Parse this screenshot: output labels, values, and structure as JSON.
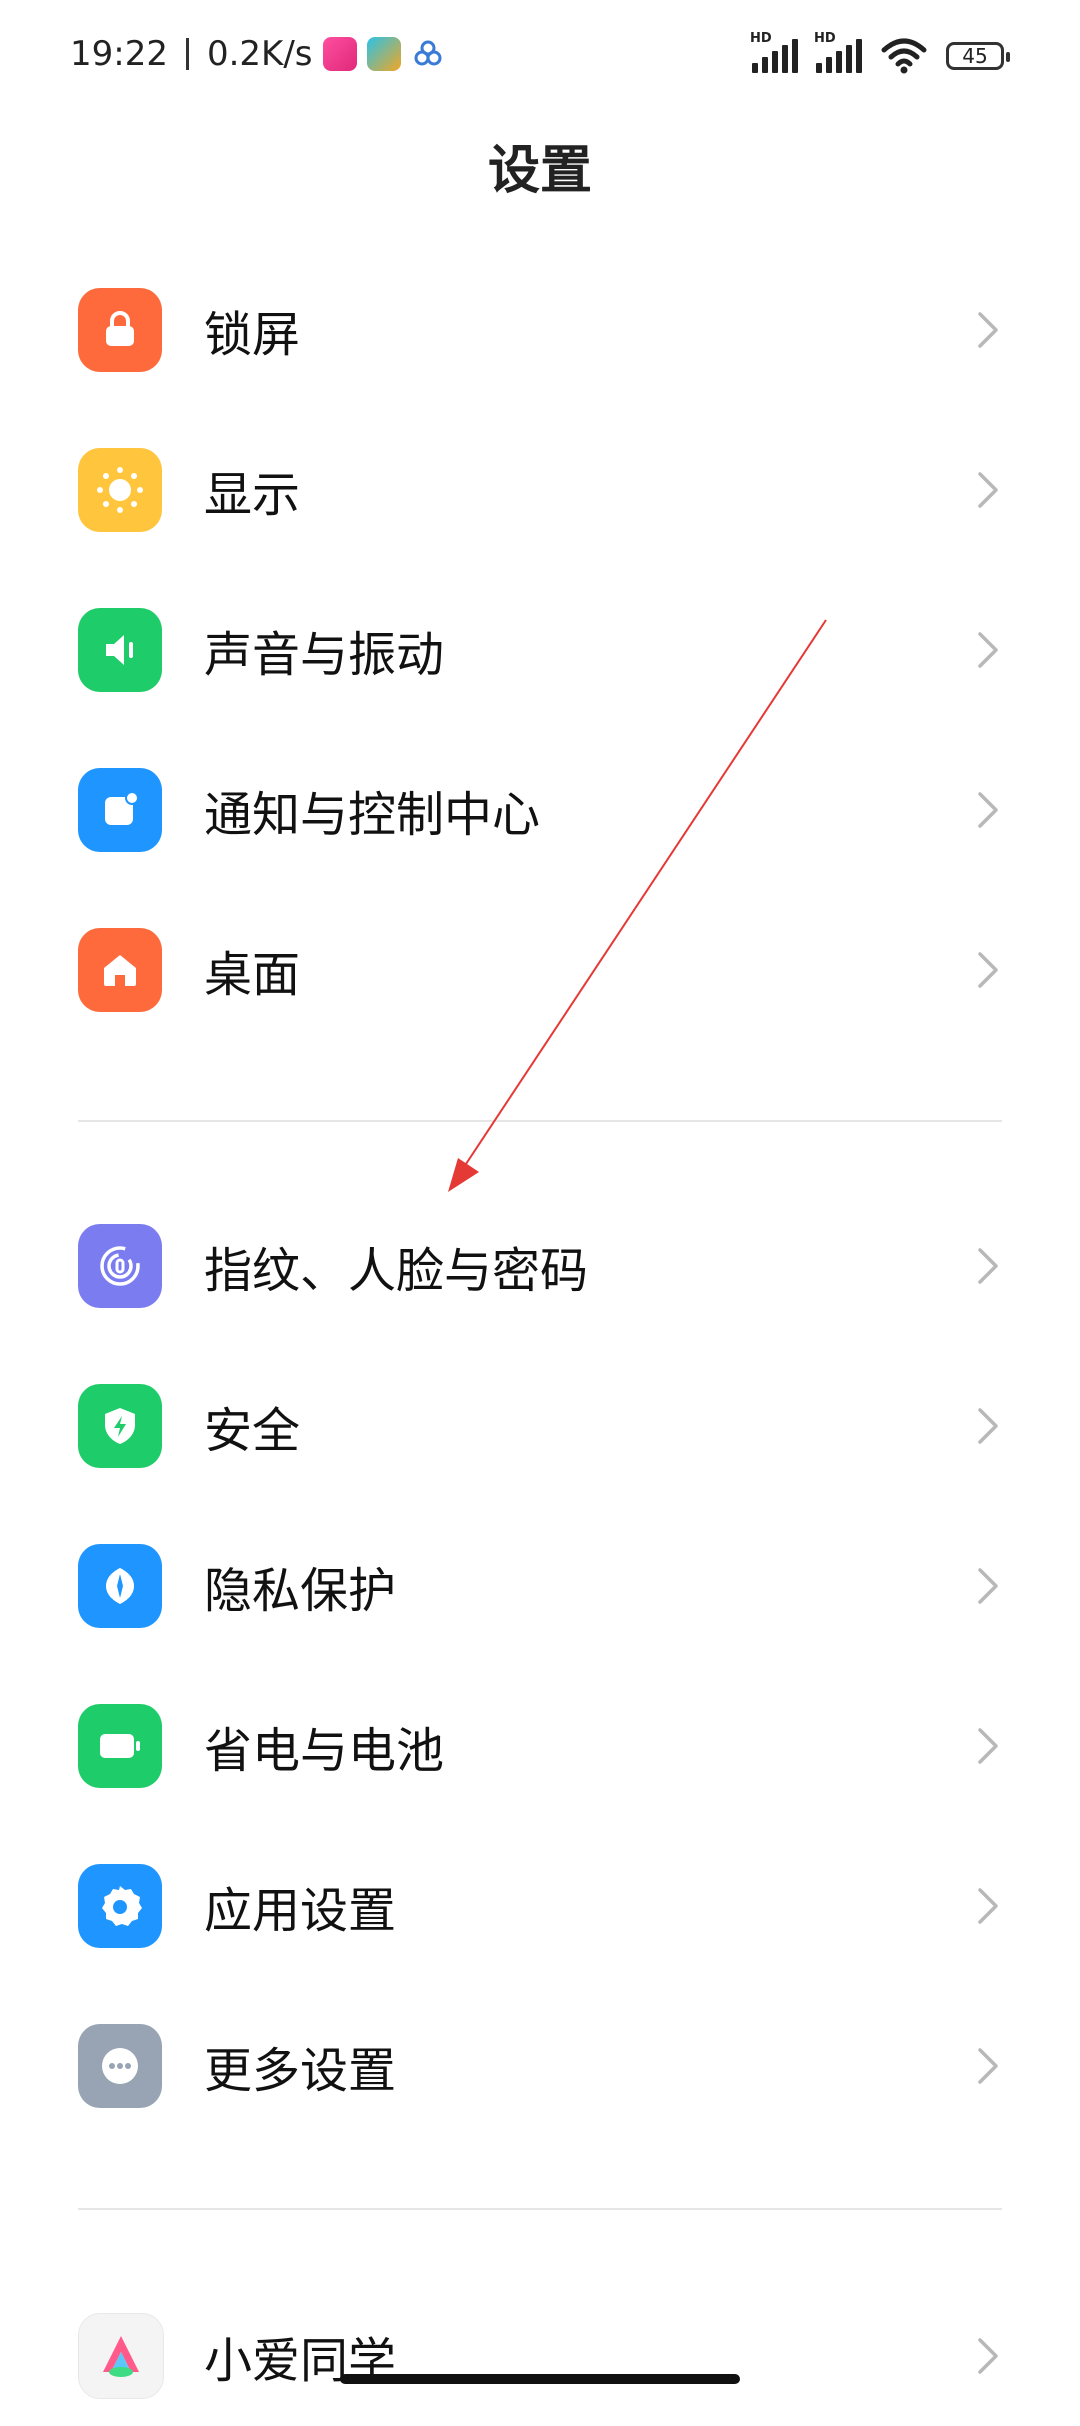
{
  "status_bar": {
    "time": "19:22",
    "net_speed": "0.2K/s",
    "battery_level": "45",
    "hd1": "HD",
    "hd2": "HD"
  },
  "header": {
    "title": "设置"
  },
  "groups": [
    [
      {
        "label": "锁屏",
        "icon": "lock-icon",
        "color": "#FF6A3D"
      },
      {
        "label": "显示",
        "icon": "sun-icon",
        "color": "#FFC53D"
      },
      {
        "label": "声音与振动",
        "icon": "speaker-icon",
        "color": "#1ECC6A"
      },
      {
        "label": "通知与控制中心",
        "icon": "notification-icon",
        "color": "#1E95FF"
      },
      {
        "label": "桌面",
        "icon": "home-icon",
        "color": "#FF6A3D"
      }
    ],
    [
      {
        "label": "指纹、人脸与密码",
        "icon": "fingerprint-icon",
        "color": "#7A7CF0"
      },
      {
        "label": "安全",
        "icon": "shield-icon",
        "color": "#1ECC6A"
      },
      {
        "label": "隐私保护",
        "icon": "privacy-icon",
        "color": "#1E95FF"
      },
      {
        "label": "省电与电池",
        "icon": "battery-icon",
        "color": "#1ECC6A"
      },
      {
        "label": "应用设置",
        "icon": "gear-icon",
        "color": "#1E95FF"
      },
      {
        "label": "更多设置",
        "icon": "more-icon",
        "color": "#98A4B4"
      }
    ],
    [
      {
        "label": "小爱同学",
        "icon": "xiaoai-icon",
        "color": "#F4F4F4"
      }
    ]
  ],
  "annotation": {
    "color": "#E53935"
  }
}
